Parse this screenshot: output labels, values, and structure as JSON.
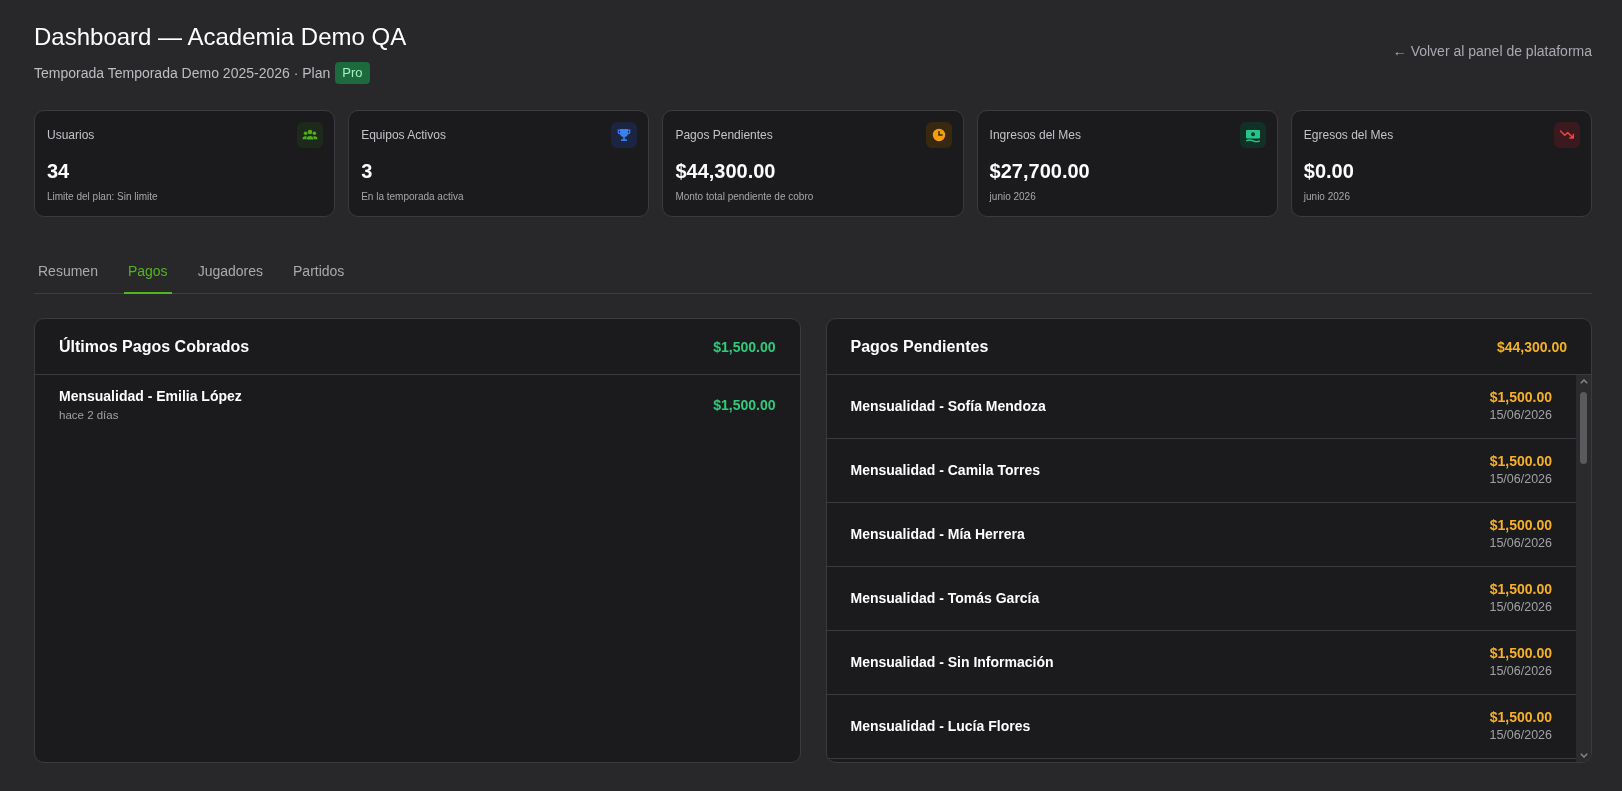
{
  "header": {
    "title": "Dashboard — Academia Demo QA",
    "subtitle": "Temporada Temporada Demo 2025-2026 · Plan",
    "plan_badge": "Pro",
    "back_link": "← Volver al panel de plataforma"
  },
  "stats": [
    {
      "kind": "users",
      "label": "Usuarios",
      "value": "34",
      "note": "Limite del plan: Sin limite"
    },
    {
      "kind": "trophy",
      "label": "Equipos Activos",
      "value": "3",
      "note": "En la temporada activa"
    },
    {
      "kind": "clock",
      "label": "Pagos Pendientes",
      "value": "$44,300.00",
      "note": "Monto total pendiente de cobro"
    },
    {
      "kind": "banknote",
      "label": "Ingresos del Mes",
      "value": "$27,700.00",
      "note": "junio 2026"
    },
    {
      "kind": "trend-down",
      "label": "Egresos del Mes",
      "value": "$0.00",
      "note": "junio 2026"
    }
  ],
  "tabs": [
    {
      "label": "Resumen",
      "selected": false
    },
    {
      "label": "Pagos",
      "selected": true
    },
    {
      "label": "Jugadores",
      "selected": false
    },
    {
      "label": "Partidos",
      "selected": false
    }
  ],
  "recent_payments": {
    "title": "Últimos Pagos Cobrados",
    "total": "$1,500.00",
    "items": [
      {
        "concept": "Mensualidad - Emilia López",
        "time": "hace 2 días",
        "amount": "$1,500.00"
      }
    ]
  },
  "pending_payments": {
    "title": "Pagos Pendientes",
    "total": "$44,300.00",
    "items": [
      {
        "concept": "Mensualidad - Sofía Mendoza",
        "amount": "$1,500.00",
        "date": "15/06/2026"
      },
      {
        "concept": "Mensualidad - Camila Torres",
        "amount": "$1,500.00",
        "date": "15/06/2026"
      },
      {
        "concept": "Mensualidad - Mía Herrera",
        "amount": "$1,500.00",
        "date": "15/06/2026"
      },
      {
        "concept": "Mensualidad - Tomás García",
        "amount": "$1,500.00",
        "date": "15/06/2026"
      },
      {
        "concept": "Mensualidad - Sin Información",
        "amount": "$1,500.00",
        "date": "15/06/2026"
      },
      {
        "concept": "Mensualidad - Lucía Flores",
        "amount": "$1,500.00",
        "date": "15/06/2026"
      }
    ]
  }
}
